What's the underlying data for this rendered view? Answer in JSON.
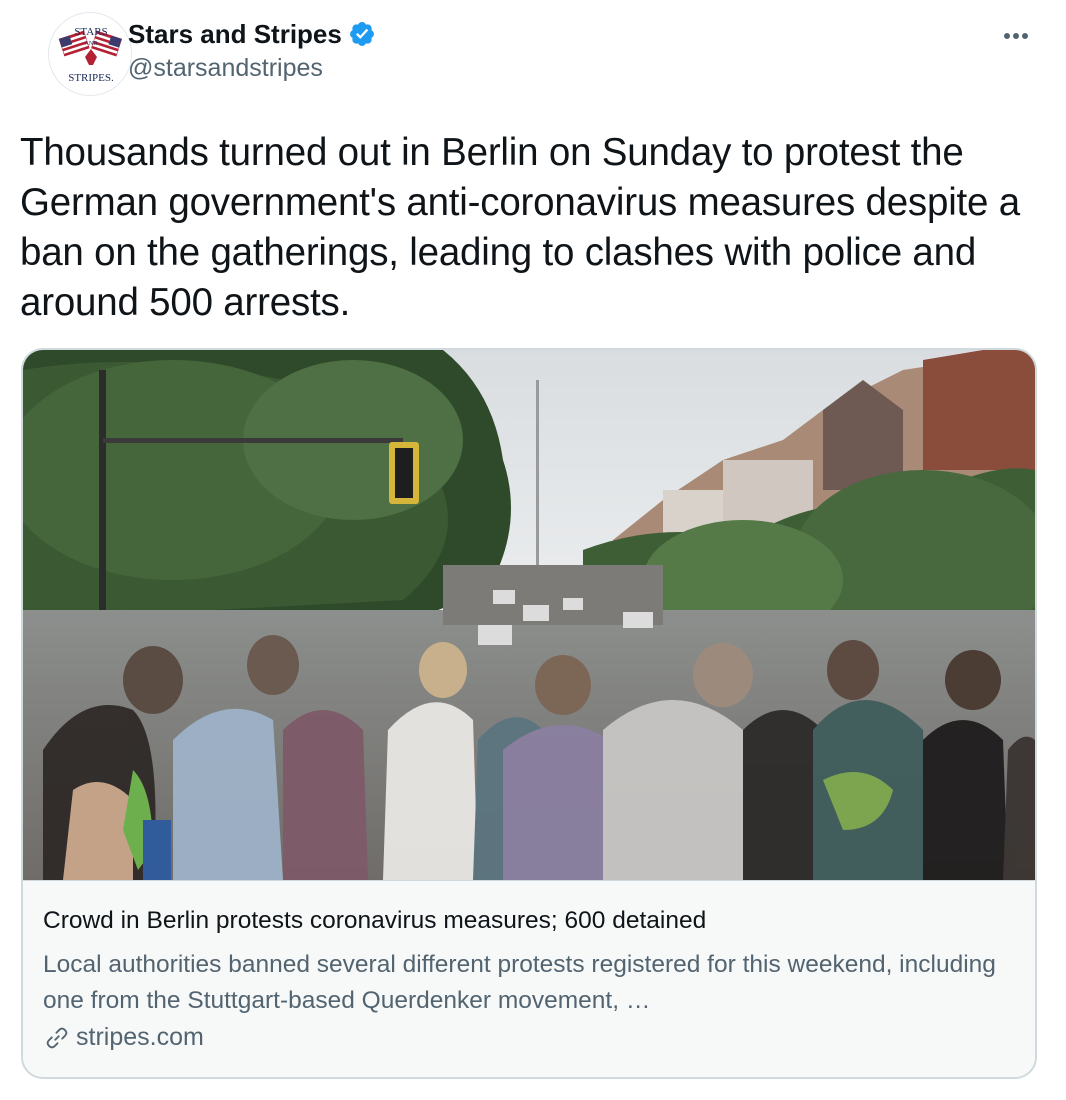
{
  "author": {
    "display_name": "Stars and Stripes",
    "handle": "@starsandstripes",
    "verified": true,
    "avatar_text": {
      "top": "STARS",
      "middle": "AND",
      "bottom": "STRIPES."
    }
  },
  "tweet": {
    "text": "Thousands turned out in Berlin on Sunday to protest the German government's anti-coronavirus measures despite a ban on the gatherings, leading to clashes with police and around 500 arrests."
  },
  "card": {
    "title": "Crowd in Berlin protests coronavirus measures; 600 detained",
    "description": "Local authorities banned several different protests registered for this weekend, including one from the Stuttgart-based Querdenker movement, …",
    "domain": "stripes.com"
  },
  "icons": {
    "verified": "verified-badge-icon",
    "more": "more-options-icon",
    "link": "link-icon"
  },
  "colors": {
    "verified_blue": "#1d9bf0",
    "secondary_text": "#536471",
    "primary_text": "#0f1419",
    "card_border": "#cfd9de",
    "card_bg": "#f7f9f9"
  }
}
